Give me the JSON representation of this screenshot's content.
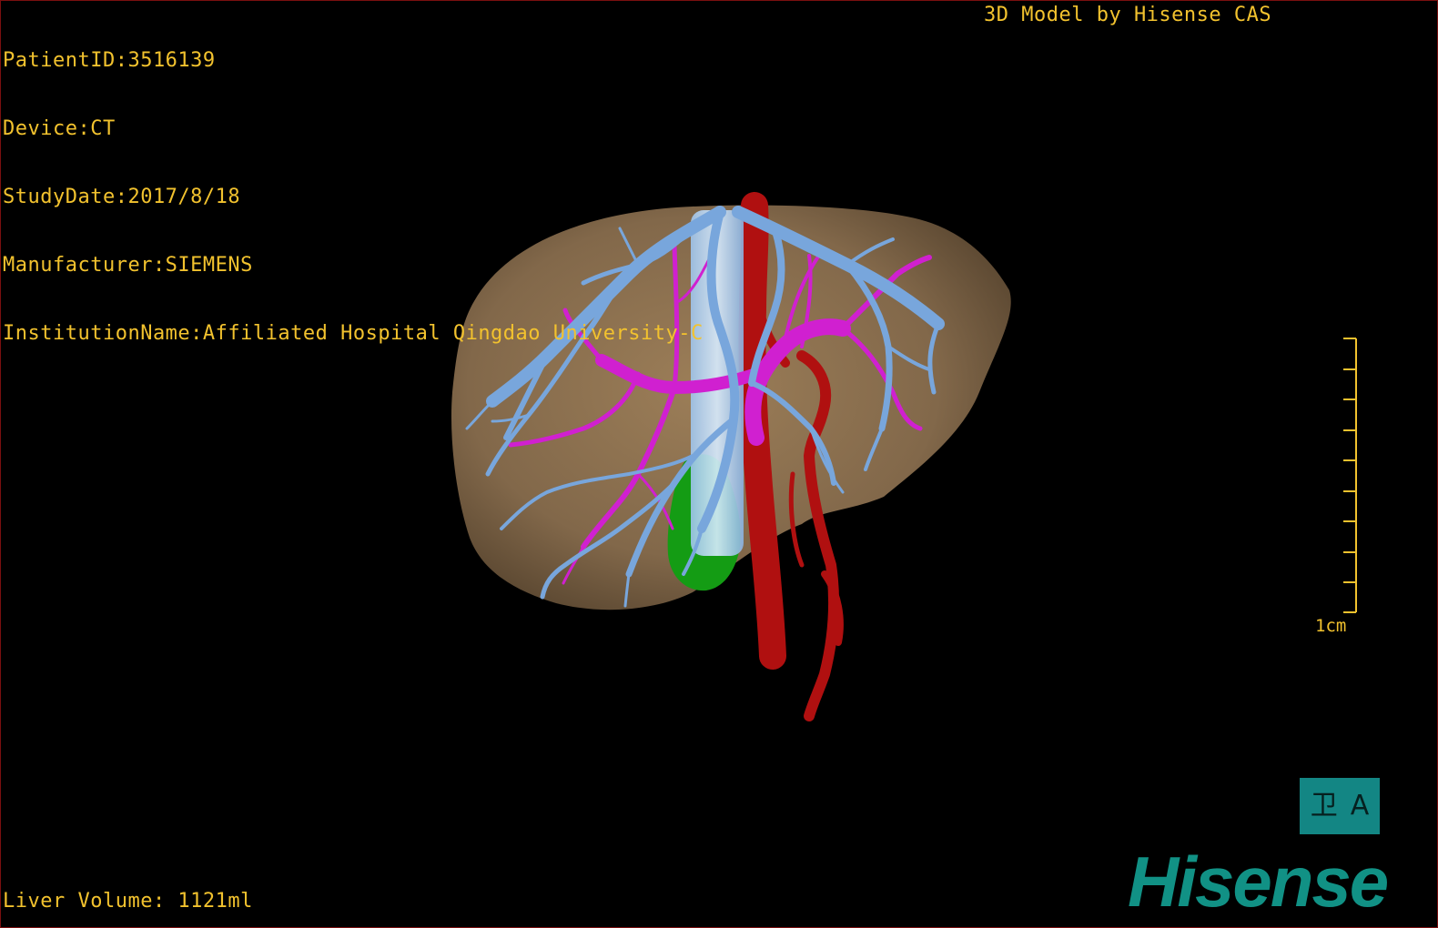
{
  "info": {
    "patient_id": "PatientID:3516139",
    "device": "Device:CT",
    "study_date": "StudyDate:2017/8/18",
    "manufacturer": "Manufacturer:SIEMENS",
    "institution": "InstitutionName:Affiliated Hospital Qingdao University-C"
  },
  "brand_top": "3D Model by Hisense CAS",
  "liver_volume": "Liver Volume: 1121ml",
  "scale": {
    "label": "1cm"
  },
  "orientation": {
    "left_glyph": "卫",
    "right_glyph": "A"
  },
  "logo": "Hisense",
  "colors": {
    "hud_text": "#f2c22e",
    "liver": "#8a7050",
    "hepatic_vein": "#78a6dc",
    "portal_vein": "#d020d0",
    "artery": "#b01010",
    "gallbladder": "#149c14",
    "brand": "#119185"
  }
}
